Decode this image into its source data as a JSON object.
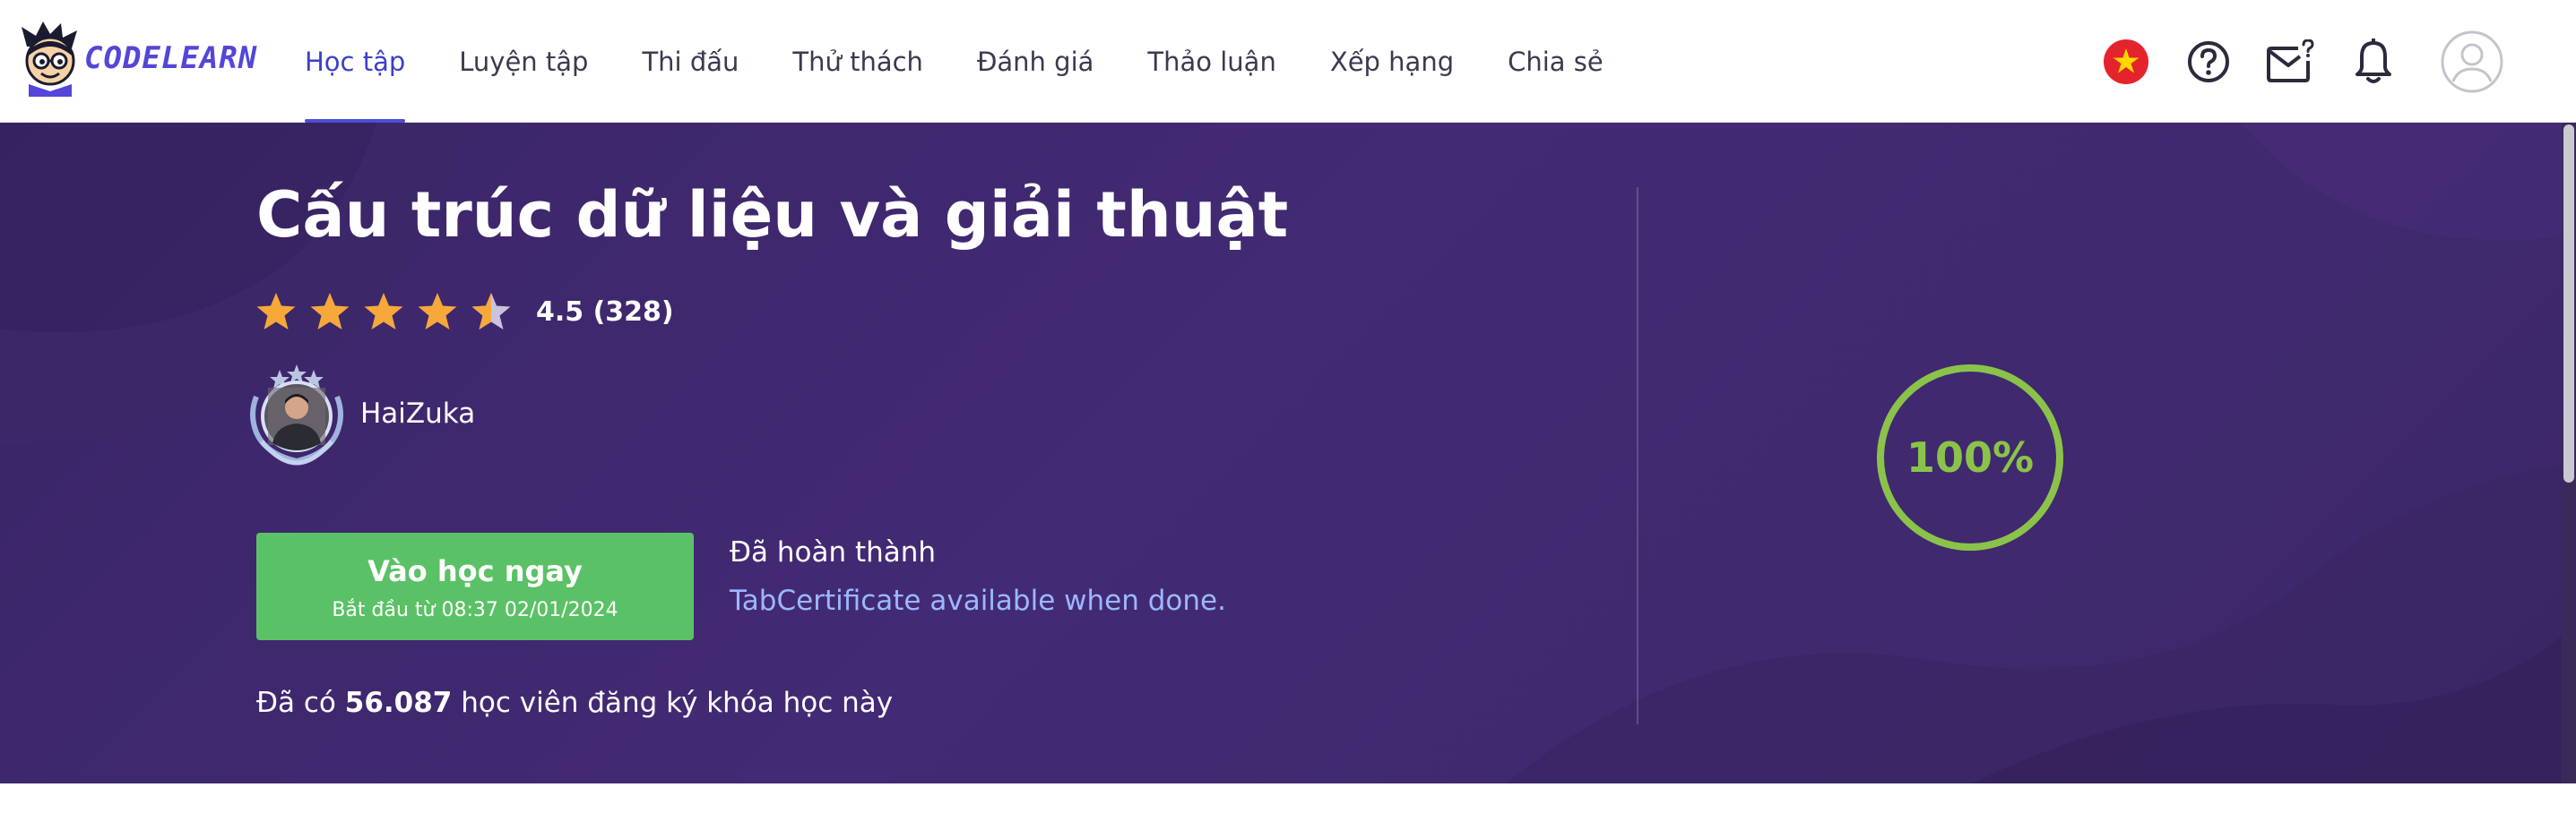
{
  "brand": {
    "name": "CODELEARN",
    "logo_icon": "mascot-logo"
  },
  "nav": {
    "items": [
      {
        "label": "Học tập",
        "active": true
      },
      {
        "label": "Luyện tập",
        "active": false
      },
      {
        "label": "Thi đấu",
        "active": false
      },
      {
        "label": "Thử thách",
        "active": false
      },
      {
        "label": "Đánh giá",
        "active": false
      },
      {
        "label": "Thảo luận",
        "active": false
      },
      {
        "label": "Xếp hạng",
        "active": false
      },
      {
        "label": "Chia sẻ",
        "active": false
      }
    ],
    "right_icons": [
      "vietnam-flag-icon",
      "help-icon",
      "mail-question-icon",
      "bell-icon",
      "user-avatar-icon"
    ]
  },
  "course": {
    "title": "Cấu trúc dữ liệu và giải thuật",
    "rating": {
      "value": 4.5,
      "max": 5,
      "text": "4.5 (328)"
    },
    "author": {
      "name": "HaiZuka"
    },
    "cta": {
      "label": "Vào học ngay",
      "sub": "Bắt đầu từ 08:37 02/01/2024"
    },
    "status": {
      "done": "Đã hoàn thành",
      "certificate": "TabCertificate available when done."
    },
    "enrolled": {
      "prefix": "Đã có",
      "count": "56.087",
      "suffix": "học viên đăng ký khóa học này"
    },
    "progress": {
      "value": 100,
      "label": "100%"
    }
  },
  "colors": {
    "accent": "#4b4fd6",
    "hero_bg": "#422a72",
    "cta": "#5bc166",
    "progress": "#8bc34a",
    "link": "#9bb8ff",
    "star": "#f6a83a"
  }
}
